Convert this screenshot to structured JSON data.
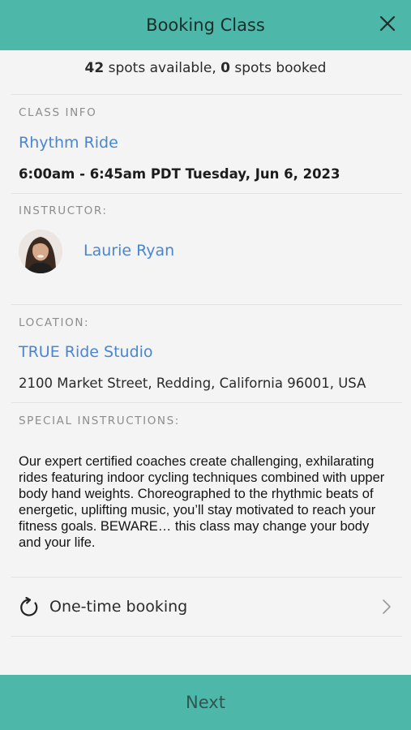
{
  "header": {
    "title": "Booking Class",
    "close_icon": "close-icon"
  },
  "spots": {
    "available_count": "42",
    "available_text": " spots available, ",
    "booked_count": "0",
    "booked_text": " spots booked"
  },
  "class_info": {
    "label": "CLASS INFO",
    "name": "Rhythm Ride",
    "datetime": "6:00am - 6:45am PDT Tuesday, Jun 6, 2023"
  },
  "instructor": {
    "label": "INSTRUCTOR:",
    "name": "Laurie Ryan"
  },
  "location": {
    "label": "LOCATION:",
    "name": "TRUE Ride Studio",
    "address": "2100 Market Street, Redding, California 96001, USA"
  },
  "special_instructions": {
    "label": "SPECIAL INSTRUCTIONS:",
    "text": "Our expert certified coaches create challenging, exhilarating rides featuring indoor cycling techniques combined with upper body hand weights. Choreographed to the rhythmic beats of energetic, uplifting music, you’ll stay motivated to reach your fitness goals. BEWARE… this class may change your body and your life."
  },
  "booking": {
    "label": "One-time booking",
    "icon": "refresh-icon"
  },
  "footer": {
    "next_label": "Next"
  },
  "colors": {
    "accent": "#4db8a9",
    "link": "#4a86d0",
    "background": "#f4f4f4"
  }
}
